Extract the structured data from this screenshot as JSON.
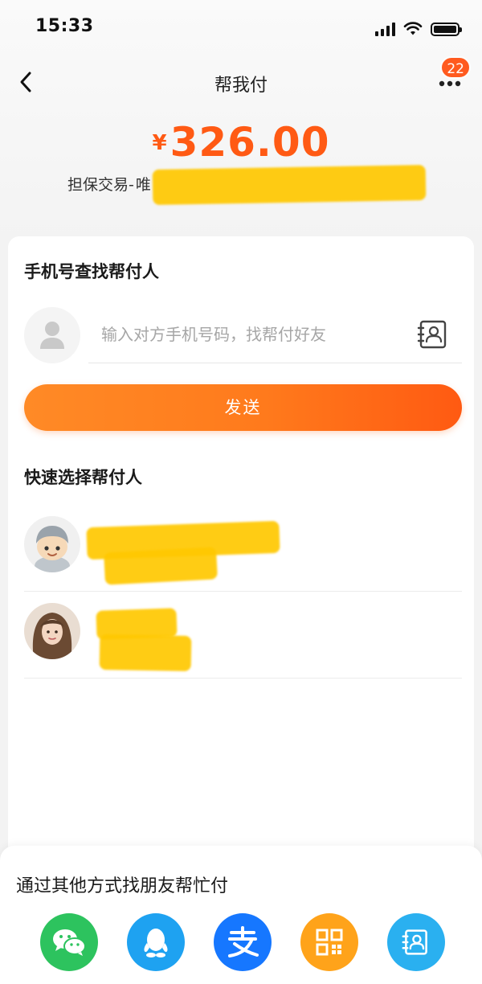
{
  "status_bar": {
    "time": "15:33"
  },
  "nav": {
    "title": "帮我付",
    "message_count": "22"
  },
  "amount": {
    "currency": "¥",
    "value": "326.00"
  },
  "trade": {
    "prefix": "担保交易-",
    "merchant_visible": "唯"
  },
  "phone_search": {
    "title": "手机号查找帮付人",
    "placeholder": "输入对方手机号码，找帮付好友"
  },
  "send_button": {
    "label": "发送"
  },
  "quick_select": {
    "title": "快速选择帮付人",
    "contacts": [
      {
        "name": ""
      },
      {
        "name": ""
      }
    ]
  },
  "share_panel": {
    "title": "通过其他方式找朋友帮忙付",
    "channels": [
      {
        "icon": "wechat-icon",
        "color": "#2dc35e"
      },
      {
        "icon": "qq-icon",
        "color": "#1ea2f1"
      },
      {
        "icon": "alipay-icon",
        "color": "#1677ff"
      },
      {
        "icon": "qrcode-icon",
        "color": "#ffa31a"
      },
      {
        "icon": "contact-card-icon",
        "color": "#2ab0f0"
      }
    ]
  },
  "colors": {
    "accent": "#ff5a14",
    "button_start": "#ff8a26",
    "button_end": "#ff5a12",
    "redaction": "#ffc800"
  }
}
